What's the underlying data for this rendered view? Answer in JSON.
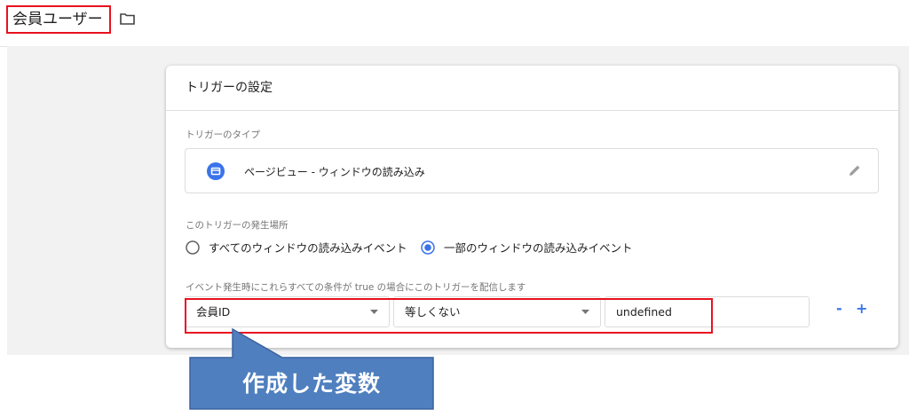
{
  "header": {
    "trigger_name": "会員ユーザー"
  },
  "card": {
    "title": "トリガーの設定",
    "type_section_label": "トリガーのタイプ",
    "trigger_type": "ページビュー - ウィンドウの読み込み",
    "fire_on_label": "このトリガーの発生場所",
    "fire_on_options": [
      {
        "label": "すべてのウィンドウの読み込みイベント",
        "selected": false
      },
      {
        "label": "一部のウィンドウの読み込みイベント",
        "selected": true
      }
    ],
    "condition_label": "イベント発生時にこれらすべての条件が true の場合にこのトリガーを配信します",
    "condition": {
      "variable": "会員ID",
      "operator": "等しくない",
      "value": "undefined"
    },
    "remove_label": "-",
    "add_label": "+"
  },
  "callout": {
    "text": "作成した変数"
  },
  "colors": {
    "accent_blue": "#3a73ea",
    "highlight_red": "#e8121f",
    "callout_fill": "#4f7fbe"
  },
  "icons": [
    "folder-icon",
    "pageview-icon",
    "pencil-icon",
    "dropdown-arrow-icon"
  ]
}
